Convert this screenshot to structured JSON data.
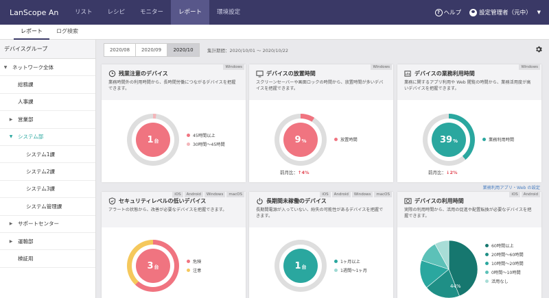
{
  "app": {
    "brand": "LanScope An"
  },
  "nav": {
    "items": [
      "リスト",
      "レシピ",
      "モニター",
      "レポート",
      "環境設定"
    ],
    "active_index": 3,
    "help_label": "ヘルプ",
    "user_label": "設定管理者（元中）"
  },
  "subtabs": {
    "items": [
      "レポート",
      "ログ検索"
    ],
    "active_index": 0
  },
  "sidebar": {
    "header": "デバイスグループ",
    "items": [
      {
        "label": "ネットワーク全体",
        "indent": 0,
        "arrow": "down"
      },
      {
        "label": "総務課",
        "indent": 1,
        "arrow": ""
      },
      {
        "label": "人事課",
        "indent": 1,
        "arrow": ""
      },
      {
        "label": "営業部",
        "indent": 1,
        "arrow": "right"
      },
      {
        "label": "システム部",
        "indent": 1,
        "arrow": "down",
        "active": true
      },
      {
        "label": "システム1課",
        "indent": 2,
        "arrow": ""
      },
      {
        "label": "システム2課",
        "indent": 2,
        "arrow": ""
      },
      {
        "label": "システム3課",
        "indent": 2,
        "arrow": ""
      },
      {
        "label": "システム管理課",
        "indent": 2,
        "arrow": ""
      },
      {
        "label": "サポートセンター",
        "indent": 1,
        "arrow": "right"
      },
      {
        "label": "運輸部",
        "indent": 1,
        "arrow": "right"
      },
      {
        "label": "検証用",
        "indent": 1,
        "arrow": ""
      }
    ]
  },
  "period": {
    "tabs": [
      "2020/08",
      "2020/09",
      "2020/10"
    ],
    "active_index": 2,
    "label": "集計期間：2020/10/01 ～ 2020/10/22"
  },
  "cards": [
    {
      "title": "残業注意のデバイス",
      "desc": "業務時間外の利用時間から、長時間労働につながるデバイスを把握できます。",
      "tags": [
        "Windows"
      ],
      "center_value": "1",
      "center_unit": "台",
      "legend": [
        {
          "label": "45時間以上",
          "color": "#f07480"
        },
        {
          "label": "30時間～45時間",
          "color": "#f3b6ba"
        }
      ],
      "ring_share": 0.02,
      "ring_color": "#f3b6ba",
      "core_color": "#f07480",
      "compare_label": "",
      "compare_value": ""
    },
    {
      "title": "デバイスの放置時間",
      "desc": "スクリーンセーバーや画面ロックの時間から、放置時間が多いデバイスを把握できます。",
      "tags": [
        "Windows"
      ],
      "center_value": "9",
      "center_unit": "%",
      "legend": [
        {
          "label": "放置時間",
          "color": "#f07480"
        }
      ],
      "ring_share": 0.09,
      "ring_color": "#f07480",
      "core_color": "#f07480",
      "compare_label": "前月比：",
      "compare_value": "↑4%"
    },
    {
      "title": "デバイスの業務利用時間",
      "desc": "業務に関するアプリ利用や Web 閲覧の時間から、業務活用度が高いデバイスを把握できます。",
      "tags": [
        "Windows"
      ],
      "center_value": "39",
      "center_unit": "%",
      "legend": [
        {
          "label": "業務利用時間",
          "color": "#2aa79f"
        }
      ],
      "ring_share": 0.39,
      "ring_color": "#2aa79f",
      "core_color": "#2aa79f",
      "compare_label": "前月比：",
      "compare_value": "↓2%",
      "link": "業務利用アプリ・Web の設定"
    },
    {
      "title": "セキュリティレベルの低いデバイス",
      "desc": "アラートの状態から、改善が必要なデバイスを把握できます。",
      "tags": [
        "iOS",
        "Android",
        "Windows",
        "macOS"
      ],
      "center_value": "3",
      "center_unit": "台",
      "legend": [
        {
          "label": "危険",
          "color": "#f07480"
        },
        {
          "label": "注意",
          "color": "#f5c85c"
        }
      ],
      "ring_share": 0.62,
      "ring_color": "#f07480",
      "ring_color2": "#f5c85c",
      "core_color": "#f07480"
    },
    {
      "title": "長期間未稼働のデバイス",
      "desc": "長期間電源が入っていない、紛失の可能性があるデバイスを把握できます。",
      "tags": [
        "iOS",
        "Android",
        "Windows",
        "macOS"
      ],
      "center_value": "1",
      "center_unit": "台",
      "legend": [
        {
          "label": "1ヶ月以上",
          "color": "#2aa79f"
        },
        {
          "label": "1週間～1ヶ月",
          "color": "#9fd9d3"
        }
      ],
      "ring_share": 0.0,
      "ring_color": "#2aa79f",
      "core_color": "#2aa79f"
    },
    {
      "title": "デバイスの利用時間",
      "desc": "実際の利用時間から、活用の促進や配置転換が必要なデバイスを把握できます。",
      "tags": [
        "iOS",
        "Android"
      ],
      "legend": [
        {
          "label": "60時間以上",
          "color": "#16776f"
        },
        {
          "label": "20時間～60時間",
          "color": "#1f8f86"
        },
        {
          "label": "10時間～20時間",
          "color": "#2aa79f"
        },
        {
          "label": "0時間～10時間",
          "color": "#5cc1b8"
        },
        {
          "label": "活用なし",
          "color": "#a8ddd7"
        }
      ],
      "pie_label": "44%"
    }
  ]
}
